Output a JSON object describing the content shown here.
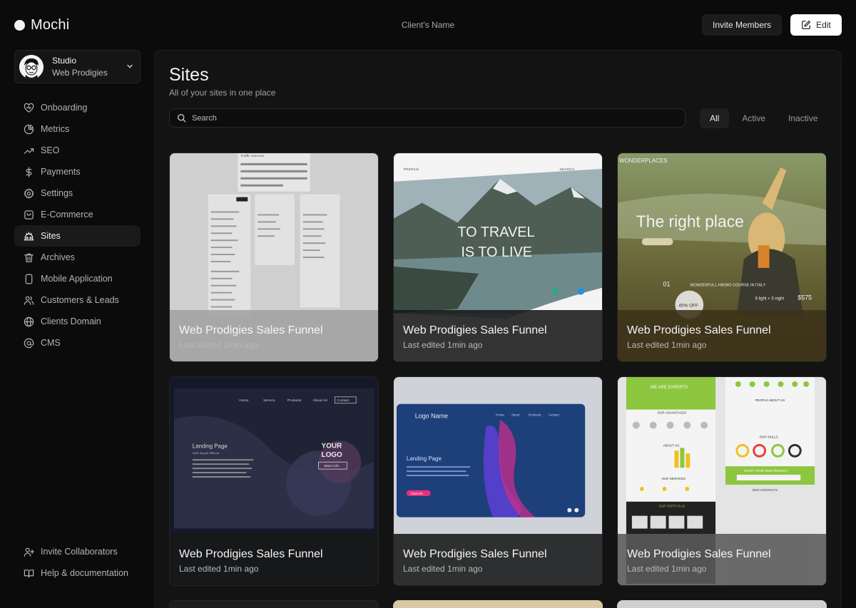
{
  "app": {
    "name": "Mochi"
  },
  "header": {
    "client_name": "Client's Name",
    "invite_label": "Invite Members",
    "edit_label": "Edit"
  },
  "studio": {
    "title": "Studio",
    "subtitle": "Web Prodigies"
  },
  "sidebar": {
    "items": [
      {
        "label": "Onboarding",
        "icon": "heart-icon"
      },
      {
        "label": "Metrics",
        "icon": "pie-chart-icon"
      },
      {
        "label": "SEO",
        "icon": "trending-icon"
      },
      {
        "label": "Payments",
        "icon": "dollar-icon"
      },
      {
        "label": "Settings",
        "icon": "gear-icon"
      },
      {
        "label": "E-Commerce",
        "icon": "shopping-icon"
      },
      {
        "label": "Sites",
        "icon": "sites-icon",
        "active": true
      },
      {
        "label": "Archives",
        "icon": "trash-icon"
      },
      {
        "label": "Mobile Application",
        "icon": "mobile-icon"
      },
      {
        "label": "Customers & Leads",
        "icon": "users-icon"
      },
      {
        "label": "Clients Domain",
        "icon": "globe-icon"
      },
      {
        "label": "CMS",
        "icon": "at-icon"
      }
    ],
    "bottom": [
      {
        "label": "Invite Collaborators",
        "icon": "user-plus-icon"
      },
      {
        "label": "Help & documentation",
        "icon": "book-icon"
      }
    ]
  },
  "main": {
    "title": "Sites",
    "subtitle": "All of your sites in one place",
    "search_placeholder": "Search",
    "filters": [
      "All",
      "Active",
      "Inactive"
    ],
    "active_filter": "All"
  },
  "sites": [
    {
      "title": "Web Prodigies Sales Funnel",
      "meta": "Last edited 1min ago",
      "thumb": "dashboard-wireframe"
    },
    {
      "title": "Web Prodigies Sales Funnel",
      "meta": "Last edited 1min ago",
      "thumb": "mountain-lake"
    },
    {
      "title": "Web Prodigies Sales Funnel",
      "meta": "Last edited 1min ago",
      "thumb": "hiking-landing"
    },
    {
      "title": "Web Prodigies Sales Funnel",
      "meta": "Last edited 1min ago",
      "thumb": "dark-landing"
    },
    {
      "title": "Web Prodigies Sales Funnel",
      "meta": "Last edited 1min ago",
      "thumb": "blue-landing"
    },
    {
      "title": "Web Prodigies Sales Funnel",
      "meta": "Last edited 1min ago",
      "thumb": "green-infographic"
    }
  ],
  "thumb_text": {
    "traffic_sources": "Traffic Sources",
    "profile": "PROFILE",
    "search": "SEARCH",
    "travel_line1": "TO TRAVEL",
    "travel_line2": "IS TO LIVE",
    "wonderplaces": "WONDERPLACES",
    "right_place": "The right place",
    "hiking_number": "01",
    "hiking_course": "WONDERFULL HIKING COURSE IN ITALY",
    "hiking_price": "$575",
    "hiking_nights": "8 light + 3 night",
    "hiking_off": "45% OFF",
    "nav_home": "Home",
    "nav_service": "Service",
    "nav_products": "Products",
    "nav_about": "About Us",
    "nav_contact": "Contact",
    "landing_page": "Landing Page",
    "liquid_effects": "with liquid effects",
    "your_logo_1": "YOUR",
    "your_logo_2": "LOGO",
    "more_info": "More info",
    "logo_name": "Logo Name",
    "sign_in": "SIGN IN",
    "we_are_experts": "WE ARE EXPERTS",
    "our_advantages": "OUR ADVANTAGES",
    "about_us": "ABOUT US",
    "our_services": "OUR SERVICES",
    "people_about_us": "PEOPLE ABOUT US",
    "our_skills": "OUR SKILLS",
    "start_project": "START YOUR NEW PROJECT",
    "our_contacts": "OUR CONTACTS",
    "our_portfolio": "OUR PORTFOLIO"
  },
  "colors": {
    "background": "#0b0b0b",
    "panel": "#131313",
    "accent_white": "#ffffff",
    "infographic_green": "#8dc63f"
  }
}
